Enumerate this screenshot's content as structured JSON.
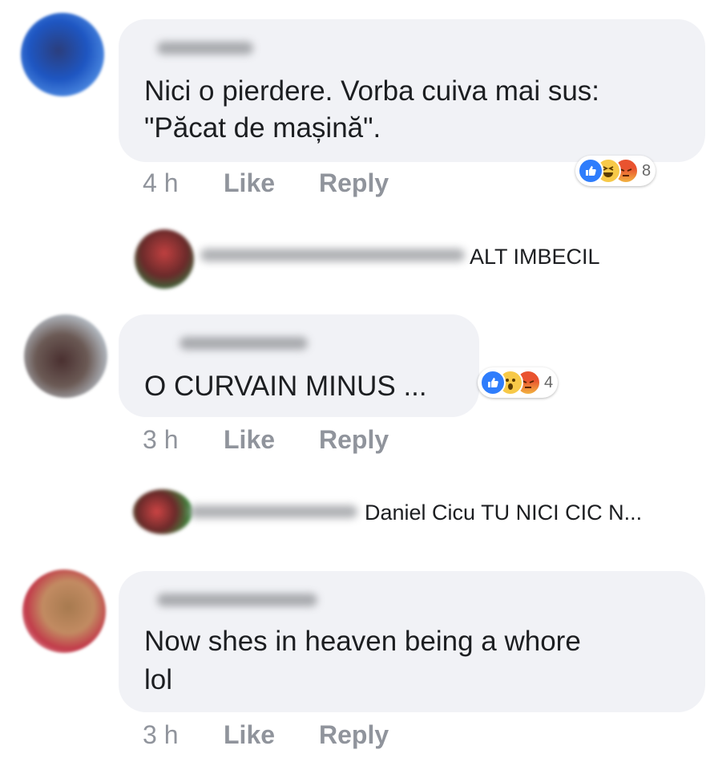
{
  "comments": [
    {
      "text_lines": [
        "Nici o pierdere. Vorba cuiva mai sus:",
        "\"Păcat de mașină\"."
      ],
      "time": "4 h",
      "like": "Like",
      "reply": "Reply",
      "reactions": [
        "like-icon",
        "haha-icon",
        "angry-icon"
      ],
      "reaction_count": "8"
    },
    {
      "text_lines": [
        "O CURVAIN MINUS ..."
      ],
      "time": "3 h",
      "like": "Like",
      "reply": "Reply",
      "reactions": [
        "like-icon",
        "wow-icon",
        "angry-icon"
      ],
      "reaction_count": "4"
    },
    {
      "text_lines": [
        "Now shes in heaven being a whore",
        "lol"
      ],
      "time": "3 h",
      "like": "Like",
      "reply": "Reply"
    }
  ],
  "replies": [
    {
      "text": "ALT IMBECIL"
    },
    {
      "text": "Daniel Cicu TU NICI CIC N..."
    }
  ],
  "colors": {
    "bubble": "#f1f2f6",
    "meta": "#90949c",
    "like_blue": "#2f7dfc",
    "angry_red": "#e9532f",
    "emoji_yellow": "#f7c948"
  }
}
